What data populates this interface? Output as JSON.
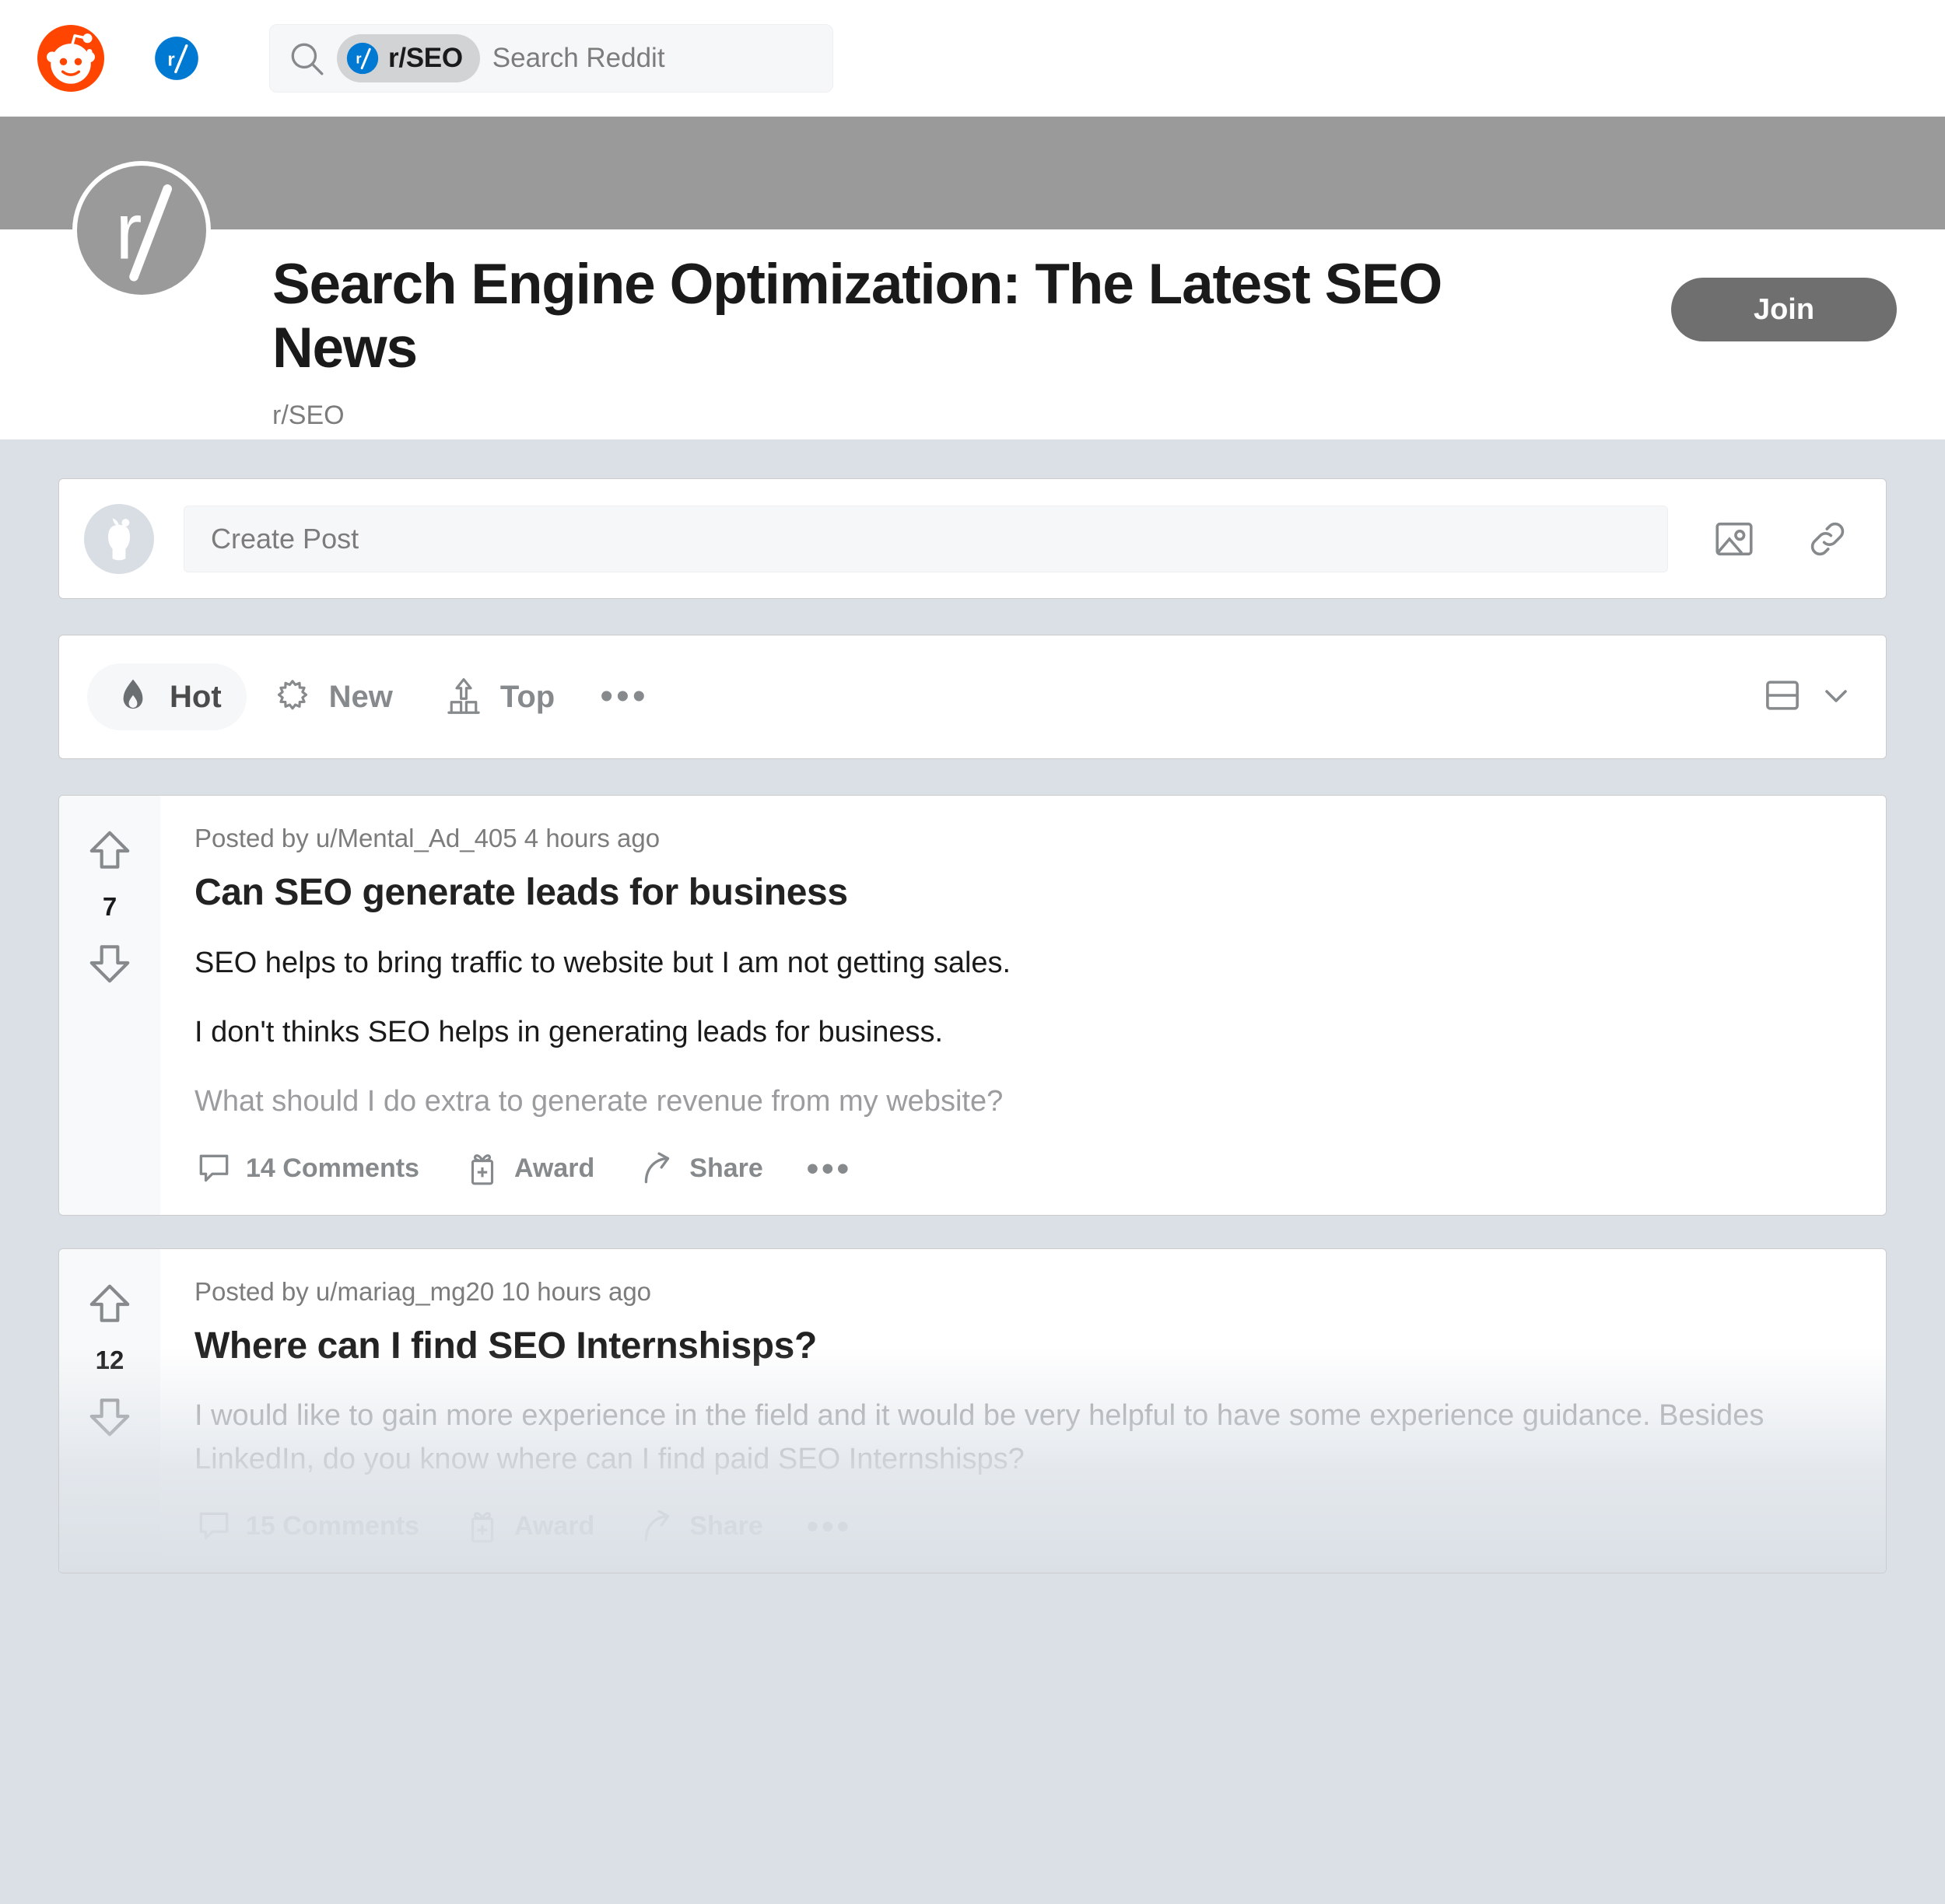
{
  "header": {
    "logo_icon": "reddit-snoo-icon",
    "sub_icon": "blue-r-slash-icon",
    "search": {
      "icon": "search-icon",
      "chip_icon": "r-slash-circle-icon",
      "chip_label": "r/SEO",
      "placeholder": "Search Reddit"
    }
  },
  "community": {
    "banner_color": "#9a9a9a",
    "avatar_icon": "r-slash-avatar-icon",
    "title": "Search Engine Optimization: The Latest SEO News",
    "name": "r/SEO",
    "join_label": "Join"
  },
  "create_post": {
    "avatar_icon": "snoo-avatar-icon",
    "placeholder": "Create Post",
    "image_icon": "image-icon",
    "link_icon": "link-icon"
  },
  "sortbar": {
    "items": [
      {
        "label": "Hot",
        "icon": "flame-icon",
        "active": true
      },
      {
        "label": "New",
        "icon": "sparkle-icon",
        "active": false
      },
      {
        "label": "Top",
        "icon": "bar-chart-up-icon",
        "active": false
      }
    ],
    "overflow_label": "•••",
    "view_icon": "card-view-icon",
    "chevron_icon": "chevron-down-icon"
  },
  "posts": [
    {
      "score": "7",
      "meta": "Posted by u/Mental_Ad_405 4 hours ago",
      "title": "Can SEO generate leads for business",
      "paragraphs": [
        {
          "text": "SEO helps to bring traffic to website but I am not getting sales.",
          "faded": false
        },
        {
          "text": "I don't thinks SEO helps in generating leads for business.",
          "faded": false
        },
        {
          "text": "What should I do extra to generate revenue from my website?",
          "faded": true
        }
      ],
      "comments_label": "14 Comments",
      "award_label": "Award",
      "share_label": "Share",
      "overflow_label": "•••"
    },
    {
      "score": "12",
      "meta": "Posted by u/mariag_mg20 10 hours ago",
      "title": "Where can I find SEO Internshisps?",
      "paragraphs": [
        {
          "text": "I would like to gain more experience in the field and it would be very helpful to have some experience guidance. Besides LinkedIn, do you know where can I find paid SEO Internshisps?",
          "faded": true
        }
      ],
      "comments_label": "15 Comments",
      "award_label": "Award",
      "share_label": "Share",
      "overflow_label": "•••"
    }
  ],
  "colors": {
    "brand_orange": "#FF4500",
    "brand_blue": "#0079D3",
    "page_background": "#DAE0E6",
    "banner_grey": "#9A9A9A",
    "join_grey": "#6F6F6F"
  }
}
